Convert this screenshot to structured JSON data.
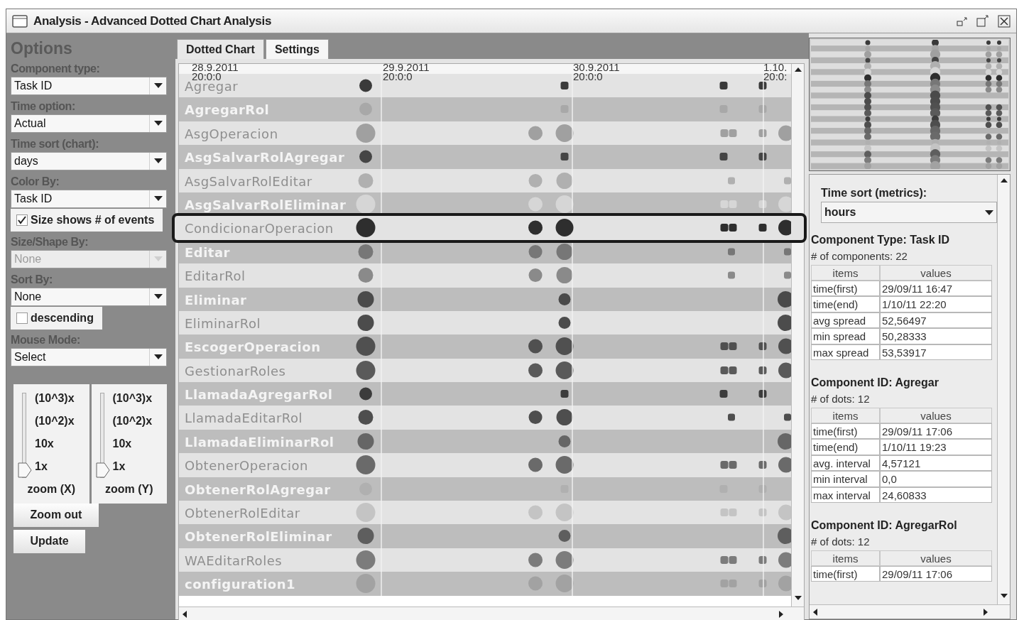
{
  "window": {
    "title": "Analysis - Advanced Dotted Chart Analysis"
  },
  "options": {
    "heading": "Options",
    "fields": [
      {
        "kind": "dropdown",
        "label": "Component type:",
        "value": "Task ID",
        "disabled": false
      },
      {
        "kind": "dropdown",
        "label": "Time option:",
        "value": "Actual",
        "disabled": false
      },
      {
        "kind": "dropdown",
        "label": "Time sort (chart):",
        "value": "days",
        "disabled": false
      },
      {
        "kind": "dropdown",
        "label": "Color By:",
        "value": "Task ID",
        "disabled": false
      },
      {
        "kind": "checkbox",
        "label": "Size shows # of events",
        "checked": true
      },
      {
        "kind": "dropdown",
        "label": "Size/Shape By:",
        "value": "None",
        "disabled": true
      },
      {
        "kind": "dropdown",
        "label": "Sort By:",
        "value": "None",
        "disabled": false
      },
      {
        "kind": "checkbox",
        "label": "descending",
        "checked": false
      },
      {
        "kind": "dropdown",
        "label": "Mouse Mode:",
        "value": "Select",
        "disabled": false
      }
    ],
    "zoom_sliders": [
      {
        "label": "zoom (X)",
        "ticks": [
          "(10^3)x",
          "(10^2)x",
          "10x",
          "1x"
        ],
        "level": 0
      },
      {
        "label": "zoom (Y)",
        "ticks": [
          "(10^3)x",
          "(10^2)x",
          "10x",
          "1x"
        ],
        "level": 0
      }
    ],
    "buttons": [
      "Zoom out",
      "Update"
    ]
  },
  "tabs": [
    {
      "label": "Dotted Chart",
      "selected": true
    },
    {
      "label": "Settings",
      "selected": false
    }
  ],
  "chart": {
    "axis_labels": [
      {
        "date": "28.9.2011",
        "time": "20:0:0"
      },
      {
        "date": "29.9.2011",
        "time": "20:0:0"
      },
      {
        "date": "30.9.2011",
        "time": "20:0:0"
      },
      {
        "date": "1.10.",
        "time": "20:0:"
      }
    ],
    "rows": [
      {
        "label": "Agregar",
        "kind": "sparse",
        "color": "#3a3a3a",
        "selected": false
      },
      {
        "label": "AgregarRol",
        "kind": "sparse",
        "color": "#a8a8a8",
        "selected": false
      },
      {
        "label": "AsgOperacion",
        "kind": "full",
        "color": "#a0a0a0",
        "selected": false
      },
      {
        "label": "AsgSalvarRolAgregar",
        "kind": "sparse",
        "color": "#454545",
        "selected": false
      },
      {
        "label": "AsgSalvarRolEditar",
        "kind": "partial",
        "color": "#b0b0b0",
        "selected": false
      },
      {
        "label": "AsgSalvarRolEliminar",
        "kind": "full",
        "color": "#d6d6d6",
        "selected": false
      },
      {
        "label": "CondicionarOperacion",
        "kind": "full",
        "color": "#2e2e2e",
        "selected": true
      },
      {
        "label": "Editar",
        "kind": "partial",
        "color": "#777777",
        "selected": false
      },
      {
        "label": "EditarRol",
        "kind": "partial",
        "color": "#8a8a8a",
        "selected": false
      },
      {
        "label": "Eliminar",
        "kind": "ends",
        "color": "#4a4a4a",
        "selected": false
      },
      {
        "label": "EliminarRol",
        "kind": "ends",
        "color": "#4c4c4c",
        "selected": false
      },
      {
        "label": "EscogerOperacion",
        "kind": "full",
        "color": "#505050",
        "selected": false
      },
      {
        "label": "GestionarRoles",
        "kind": "full",
        "color": "#5a5a5a",
        "selected": false
      },
      {
        "label": "LlamadaAgregarRol",
        "kind": "sparse",
        "color": "#3c3c3c",
        "selected": false
      },
      {
        "label": "LlamadaEditarRol",
        "kind": "partial",
        "color": "#4e4e4e",
        "selected": false
      },
      {
        "label": "LlamadaEliminarRol",
        "kind": "ends",
        "color": "#666666",
        "selected": false
      },
      {
        "label": "ObtenerOperacion",
        "kind": "full",
        "color": "#6a6a6a",
        "selected": false
      },
      {
        "label": "ObtenerRolAgregar",
        "kind": "sparse",
        "color": "#b0b0b0",
        "selected": false
      },
      {
        "label": "ObtenerRolEditar",
        "kind": "full",
        "color": "#c4c4c4",
        "selected": false
      },
      {
        "label": "ObtenerRolEliminar",
        "kind": "ends",
        "color": "#5e5e5e",
        "selected": false
      },
      {
        "label": "WAEditarRoles",
        "kind": "full",
        "color": "#7c7c7c",
        "selected": false
      },
      {
        "label": "configuration1",
        "kind": "full",
        "color": "#a2a2a2",
        "selected": false
      }
    ]
  },
  "metrics": {
    "time_sort": {
      "label": "Time sort (metrics):",
      "value": "hours"
    },
    "sections": [
      {
        "title": "Component Type: Task ID",
        "count": "# of components: 22",
        "columns": [
          "items",
          "values"
        ],
        "rows": [
          [
            "time(first)",
            "29/09/11 16:47"
          ],
          [
            "time(end)",
            "1/10/11 22:20"
          ],
          [
            "avg spread",
            "52,56497"
          ],
          [
            "min spread",
            "50,28333"
          ],
          [
            "max spread",
            "53,53917"
          ]
        ]
      },
      {
        "title": "Component ID: Agregar",
        "count": "# of dots: 12",
        "columns": [
          "items",
          "values"
        ],
        "rows": [
          [
            "time(first)",
            "29/09/11 17:06"
          ],
          [
            "time(end)",
            "1/10/11 19:23"
          ],
          [
            "avg. interval",
            "4,57121"
          ],
          [
            "min interval",
            "0,0"
          ],
          [
            "max interval",
            "24,60833"
          ]
        ]
      },
      {
        "title": "Component ID: AgregarRol",
        "count": "# of dots: 12",
        "columns": [
          "items",
          "values"
        ],
        "rows": [
          [
            "time(first)",
            "29/09/11 17:06"
          ]
        ]
      }
    ]
  }
}
